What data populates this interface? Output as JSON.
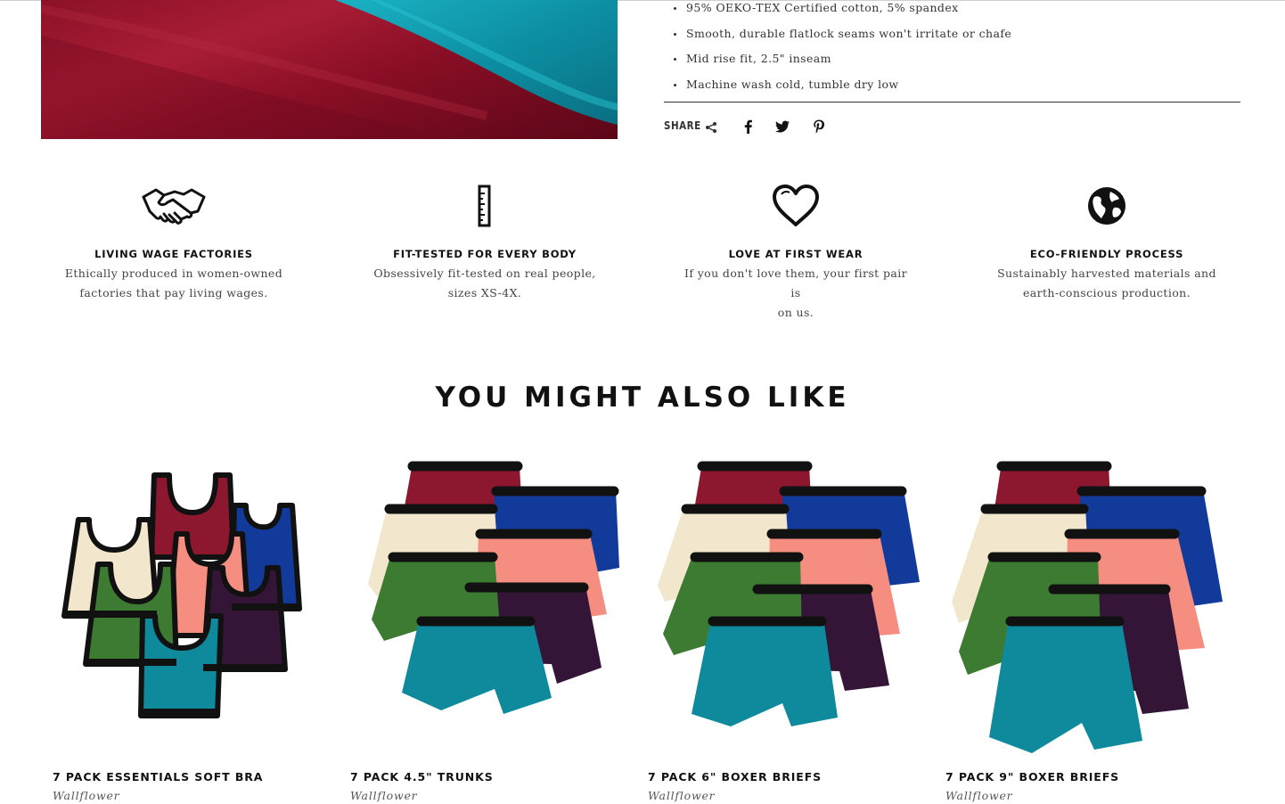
{
  "details": {
    "bullets": [
      "95% OEKO-TEX Certified cotton, 5% spandex",
      "Smooth, durable flatlock seams won't irritate or chafe",
      "Mid rise fit, 2.5\" inseam",
      "Machine wash cold, tumble dry low"
    ]
  },
  "share": {
    "label": "SHARE",
    "icons": [
      "share-icon",
      "facebook-icon",
      "twitter-icon",
      "pinterest-icon"
    ]
  },
  "features": [
    {
      "icon": "handshake-icon",
      "title": "LIVING WAGE FACTORIES",
      "line1": "Ethically produced in women-owned",
      "line2": "factories that pay living wages."
    },
    {
      "icon": "ruler-icon",
      "title": "FIT-TESTED FOR EVERY BODY",
      "line1": "Obsessively fit-tested on real people,",
      "line2": "sizes XS-4X."
    },
    {
      "icon": "heart-icon",
      "title": "LOVE AT FIRST WEAR",
      "line1": "If you don't love them, your first pair is",
      "line2": "on us."
    },
    {
      "icon": "globe-icon",
      "title": "ECO-FRIENDLY PROCESS",
      "line1": "Sustainably harvested materials and",
      "line2": "earth-conscious production."
    }
  ],
  "recommendations": {
    "heading": "YOU MIGHT ALSO LIKE",
    "products": [
      {
        "name": "7 PACK ESSENTIALS SOFT BRA",
        "brand": "Wallflower"
      },
      {
        "name": "7 PACK 4.5\" TRUNKS",
        "brand": "Wallflower"
      },
      {
        "name": "7 PACK 6\" BOXER BRIEFS",
        "brand": "Wallflower"
      },
      {
        "name": "7 PACK 9\" BOXER BRIEFS",
        "brand": "Wallflower"
      }
    ]
  },
  "colors": {
    "burgundy": "#8e1730",
    "teal": "#0e8a9c",
    "royal_blue": "#123a9a",
    "cream": "#f2e6cc",
    "coral": "#f58d80",
    "green": "#3d7a32",
    "plum": "#341538",
    "waistband": "#111111"
  }
}
